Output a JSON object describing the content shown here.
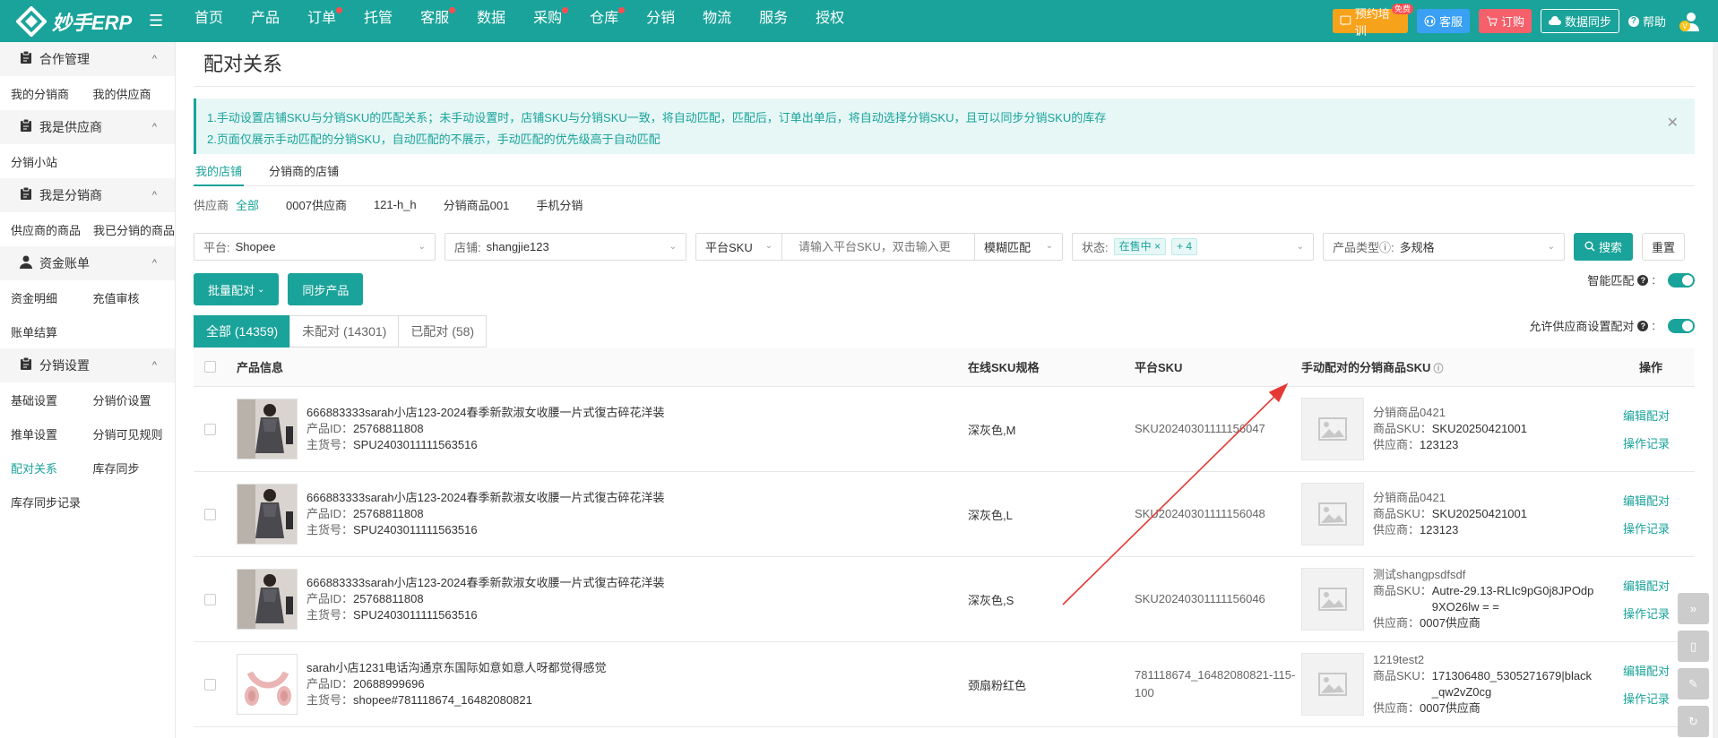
{
  "app": {
    "logo_text": "妙手ERP"
  },
  "nav": [
    "首页",
    "产品",
    "订单",
    "托管",
    "客服",
    "数据",
    "采购",
    "仓库",
    "分销",
    "物流",
    "服务",
    "授权"
  ],
  "nav_dots": [
    false,
    false,
    true,
    false,
    true,
    false,
    true,
    true,
    false,
    false,
    false,
    false
  ],
  "topbar": {
    "training": "预约培训",
    "training_badge": "免费",
    "cs": "客服",
    "order": "订购",
    "sync": "数据同步",
    "help": "帮助"
  },
  "sidebar": {
    "groups": [
      {
        "title": "合作管理",
        "icon": "clipboard-icon",
        "links": [
          "我的分销商",
          "我的供应商"
        ]
      },
      {
        "title": "我是供应商",
        "icon": "clipboard-icon",
        "links": [
          "分销小站"
        ]
      },
      {
        "title": "我是分销商",
        "icon": "clipboard-icon",
        "links": [
          "供应商的商品",
          "我已分销的商品"
        ]
      },
      {
        "title": "资金账单",
        "icon": "user-icon",
        "links": [
          "资金明细",
          "充值审核",
          "账单结算"
        ]
      },
      {
        "title": "分销设置",
        "icon": "clipboard-icon",
        "links": [
          "基础设置",
          "分销价设置",
          "推单设置",
          "分销可见规则",
          "配对关系",
          "库存同步",
          "库存同步记录"
        ]
      }
    ],
    "active": "配对关系"
  },
  "page": {
    "title": "配对关系",
    "notice_1": "1.手动设置店铺SKU与分销SKU的匹配关系；未手动设置时，店铺SKU与分销SKU一致，将自动匹配，匹配后，订单出单后，将自动选择分销SKU，且可以同步分销SKU的库存",
    "notice_2": "2.页面仅展示手动匹配的分销SKU，自动匹配的不展示，手动匹配的优先级高于自动匹配",
    "store_tabs": [
      "我的店铺",
      "分销商的店铺"
    ],
    "supplier_label": "供应商",
    "suppliers": [
      "全部",
      "0007供应商",
      "121-h_h",
      "分销商品001",
      "手机分销"
    ]
  },
  "filters": {
    "platform_label": "平台:",
    "platform_value": "Shopee",
    "store_label": "店铺:",
    "store_value": "shangjie123",
    "sku_type": "平台SKU",
    "sku_placeholder": "请输入平台SKU，双击输入更",
    "match_mode": "模糊匹配",
    "status_label": "状态:",
    "status_tag": "在售中",
    "status_more": "+ 4",
    "ptype_label": "产品类型",
    "ptype_value": "多规格",
    "search": "搜索",
    "reset": "重置"
  },
  "actions": {
    "batch": "批量配对",
    "sync": "同步产品",
    "smart": "智能匹配",
    "allow": "允许供应商设置配对"
  },
  "tabs": [
    "全部 (14359)",
    "未配对 (14301)",
    "已配对 (58)"
  ],
  "columns": {
    "product": "产品信息",
    "spec": "在线SKU规格",
    "sku": "平台SKU",
    "dist": "手动配对的分销商品SKU",
    "op": "操作"
  },
  "labels": {
    "pid": "产品ID：",
    "spu": "主货号：",
    "dsku": "商品SKU：",
    "dsup": "供应商：",
    "edit": "编辑配对",
    "log": "操作记录"
  },
  "rows": [
    {
      "name": "666883333sarah小店123-2024春季新款淑女收腰一片式復古碎花洋装",
      "pid": "25768811808",
      "spu": "SPU2403011111563516",
      "spec": "深灰色,M",
      "sku": "SKU20240301111156047",
      "d_name": "分销商品0421",
      "d_sku": "SKU20250421001",
      "d_sup": "123123"
    },
    {
      "name": "666883333sarah小店123-2024春季新款淑女收腰一片式復古碎花洋装",
      "pid": "25768811808",
      "spu": "SPU2403011111563516",
      "spec": "深灰色,L",
      "sku": "SKU20240301111156048",
      "d_name": "分销商品0421",
      "d_sku": "SKU20250421001",
      "d_sup": "123123"
    },
    {
      "name": "666883333sarah小店123-2024春季新款淑女收腰一片式復古碎花洋装",
      "pid": "25768811808",
      "spu": "SPU2403011111563516",
      "spec": "深灰色,S",
      "sku": "SKU20240301111156046",
      "d_name": "测试shangpsdfsdf",
      "d_sku": "Autre-29.13-RLIc9pG0j8JPOdp9XO26lw = =",
      "d_sup": "0007供应商"
    },
    {
      "name": "sarah小店1231电话沟通京东国际如意如意人呀都觉得感觉",
      "pid": "20688999696",
      "spu": "shopee#781118674_16482080821",
      "spec": "颈扇粉红色",
      "sku": "781118674_16482080821-115-100",
      "d_name": "1219test2",
      "d_sku": "171306480_5305271679|black_qw2vZ0cg",
      "d_sup": "0007供应商"
    }
  ]
}
